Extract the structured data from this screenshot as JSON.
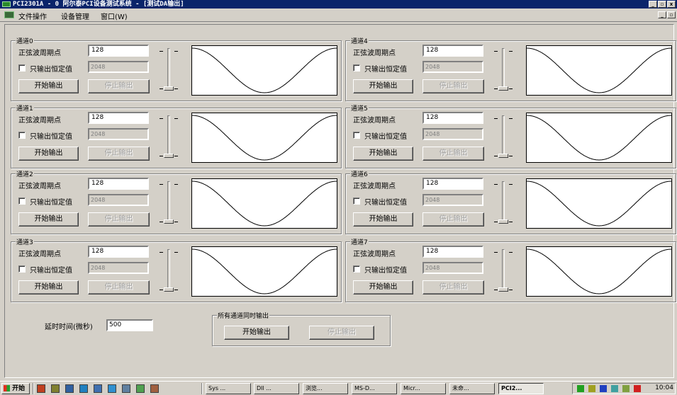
{
  "window": {
    "title": "PCI2301A - 0 阿尔泰PCI设备测试系统 - [测试DA输出]"
  },
  "menu": {
    "items": [
      "文件操作",
      "设备管理",
      "窗口(W)"
    ]
  },
  "labels": {
    "period": "正弦波周期点",
    "const_checkbox": "只输出恒定值",
    "start": "开始输出",
    "stop": "停止输出"
  },
  "channels": [
    {
      "name": "通道0",
      "period": "128",
      "constant": "2048"
    },
    {
      "name": "通道1",
      "period": "128",
      "constant": "2048"
    },
    {
      "name": "通道2",
      "period": "128",
      "constant": "2048"
    },
    {
      "name": "通道3",
      "period": "128",
      "constant": "2048"
    },
    {
      "name": "通道4",
      "period": "128",
      "constant": "2048"
    },
    {
      "name": "通道5",
      "period": "128",
      "constant": "2048"
    },
    {
      "name": "通道6",
      "period": "128",
      "constant": "2048"
    },
    {
      "name": "通道7",
      "period": "128",
      "constant": "2048"
    }
  ],
  "all_channels": {
    "title": "所有通道同时输出",
    "start": "开始输出",
    "stop": "停止输出"
  },
  "delay": {
    "label": "延时时间(微秒)",
    "value": "500"
  },
  "taskbar": {
    "start": "开始",
    "tasks": [
      "Sys ...",
      "Dll ...",
      "浏览...",
      "MS-D...",
      "Micr...",
      "未命...",
      "PCI2..."
    ],
    "clock": "10:04"
  },
  "icons": {
    "app": "pci-app-icon",
    "minimize": "minimize-icon",
    "restore": "restore-icon",
    "close": "close-icon"
  },
  "colors": {
    "titlebar": "#0a246a",
    "face": "#d4d0c8",
    "wave": "#000000"
  }
}
